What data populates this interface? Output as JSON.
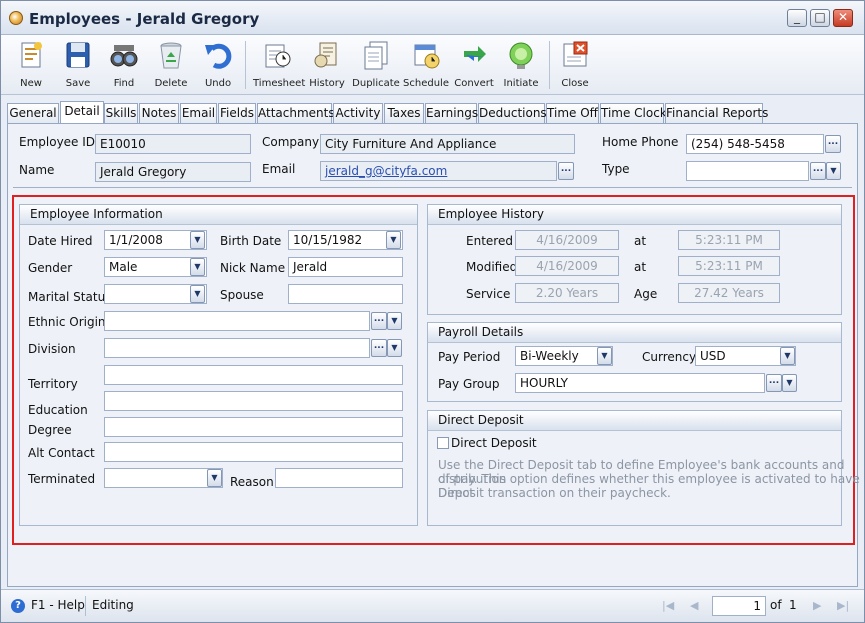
{
  "window": {
    "title": "Employees - Jerald Gregory"
  },
  "toolbar": {
    "new": "New",
    "save": "Save",
    "find": "Find",
    "delete": "Delete",
    "undo": "Undo",
    "timesheet": "Timesheet",
    "history": "History",
    "duplicate": "Duplicate",
    "schedule": "Schedule",
    "convert": "Convert",
    "initiate": "Initiate",
    "close": "Close"
  },
  "tabs": [
    "General",
    "Detail",
    "Skills",
    "Notes",
    "Email",
    "Fields",
    "Attachments",
    "Activity",
    "Taxes",
    "Earnings",
    "Deductions",
    "Time Off",
    "Time Clock",
    "Financial Reports"
  ],
  "header": {
    "employee_id_label": "Employee ID",
    "employee_id": "E10010",
    "name_label": "Name",
    "name": "Jerald Gregory",
    "company_label": "Company",
    "company": "City Furniture And Appliance",
    "email_label": "Email",
    "email": "jerald_g@cityfa.com",
    "home_phone_label": "Home Phone",
    "home_phone": "(254) 548-5458",
    "type_label": "Type",
    "type": ""
  },
  "employee_info": {
    "title": "Employee Information",
    "date_hired_label": "Date Hired",
    "date_hired": "1/1/2008",
    "birth_date_label": "Birth Date",
    "birth_date": "10/15/1982",
    "gender_label": "Gender",
    "gender": "Male",
    "nick_name_label": "Nick Name",
    "nick_name": "Jerald",
    "marital_status_label": "Marital Status",
    "marital_status": "",
    "spouse_label": "Spouse",
    "spouse": "",
    "ethnic_origin_label": "Ethnic Origin",
    "ethnic_origin": "",
    "division_label": "Division",
    "division": "",
    "territory_label": "Territory",
    "territory": "",
    "education_label": "Education",
    "education": "",
    "degree_label": "Degree",
    "degree": "",
    "alt_contact_label": "Alt Contact",
    "alt_contact": "",
    "terminated_label": "Terminated",
    "terminated": "",
    "reason_label": "Reason",
    "reason": ""
  },
  "employee_history": {
    "title": "Employee History",
    "entered_label": "Entered",
    "entered_date": "4/16/2009",
    "at_label": "at",
    "entered_time": "5:23:11 PM",
    "modified_label": "Modified",
    "modified_date": "4/16/2009",
    "modified_time": "5:23:11 PM",
    "service_label": "Service",
    "service": "2.20 Years",
    "age_label": "Age",
    "age": "27.42 Years"
  },
  "payroll": {
    "title": "Payroll Details",
    "pay_period_label": "Pay Period",
    "pay_period": "Bi-Weekly",
    "currency_label": "Currency",
    "currency": "USD",
    "pay_group_label": "Pay Group",
    "pay_group": "HOURLY"
  },
  "direct_deposit": {
    "title": "Direct Deposit",
    "checkbox_label": "Direct Deposit",
    "checked": false,
    "hint_lines": [
      "Use the Direct Deposit tab to define Employee's bank accounts and distribution",
      "of pay. This option defines whether this employee is activated to have Direct",
      "Deposit transaction on their paycheck."
    ]
  },
  "status": {
    "help": "F1 - Help",
    "mode": "Editing",
    "page": "1",
    "of_label": "of",
    "total": "1"
  },
  "colors": {
    "highlight_border": "#e02020",
    "link": "#2a4fb0"
  }
}
